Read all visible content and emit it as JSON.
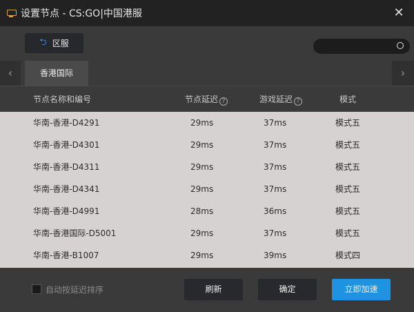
{
  "window": {
    "title": "设置节点 - CS:GO|中国港服",
    "close_glyph": "✕"
  },
  "toolbar": {
    "region_button_label": "区服",
    "search_placeholder": "",
    "search_value": ""
  },
  "tabs": [
    {
      "label": "香港国际",
      "active": true
    }
  ],
  "table": {
    "columns": [
      "节点名称和编号",
      "节点延迟",
      "游戏延迟",
      "模式"
    ],
    "rows": [
      {
        "name": "华南-香港-D4291",
        "node_latency": "29ms",
        "game_latency": "37ms",
        "mode": "模式五"
      },
      {
        "name": "华南-香港-D4301",
        "node_latency": "29ms",
        "game_latency": "37ms",
        "mode": "模式五"
      },
      {
        "name": "华南-香港-D4311",
        "node_latency": "29ms",
        "game_latency": "37ms",
        "mode": "模式五"
      },
      {
        "name": "华南-香港-D4341",
        "node_latency": "29ms",
        "game_latency": "37ms",
        "mode": "模式五"
      },
      {
        "name": "华南-香港-D4991",
        "node_latency": "28ms",
        "game_latency": "36ms",
        "mode": "模式五"
      },
      {
        "name": "华南-香港国际-D5001",
        "node_latency": "29ms",
        "game_latency": "37ms",
        "mode": "模式五"
      },
      {
        "name": "华南-香港-B1007",
        "node_latency": "29ms",
        "game_latency": "39ms",
        "mode": "模式四"
      }
    ]
  },
  "footer": {
    "auto_sort_label": "自动按延迟排序",
    "auto_sort_checked": false,
    "refresh_label": "刷新",
    "confirm_label": "确定",
    "accelerate_label": "立即加速"
  },
  "colors": {
    "accent": "#1f93e0",
    "icon": "#e0a040",
    "table_bg": "#d7d2d2"
  }
}
